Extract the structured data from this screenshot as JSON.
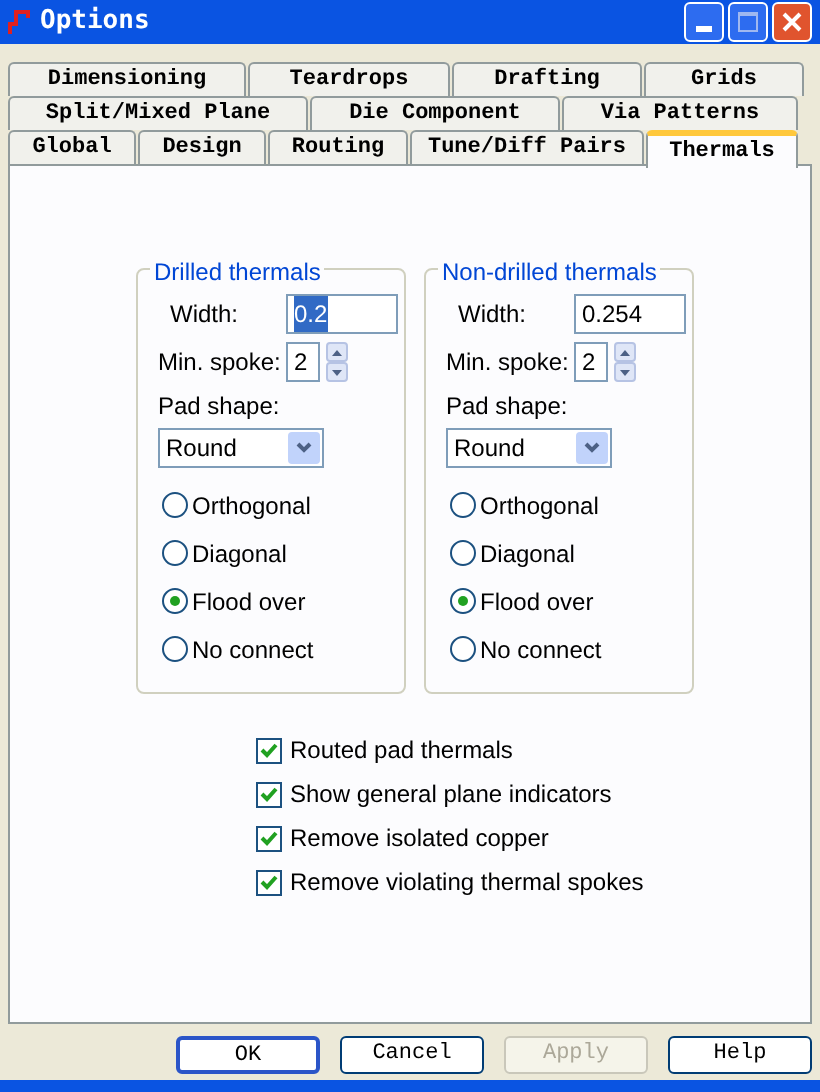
{
  "window": {
    "title": "Options"
  },
  "tab_rows": [
    [
      {
        "label": "Dimensioning",
        "selected": false
      },
      {
        "label": "Teardrops",
        "selected": false
      },
      {
        "label": "Drafting",
        "selected": false
      },
      {
        "label": "Grids",
        "selected": false
      }
    ],
    [
      {
        "label": "Split/Mixed Plane",
        "selected": false
      },
      {
        "label": "Die Component",
        "selected": false
      },
      {
        "label": "Via Patterns",
        "selected": false
      }
    ],
    [
      {
        "label": "Global",
        "selected": false
      },
      {
        "label": "Design",
        "selected": false
      },
      {
        "label": "Routing",
        "selected": false
      },
      {
        "label": "Tune/Diff Pairs",
        "selected": false
      },
      {
        "label": "Thermals",
        "selected": true
      }
    ]
  ],
  "groups": [
    {
      "title": "Drilled thermals",
      "width_label": "Width:",
      "width_value": "0.2",
      "width_text_selected": true,
      "spoke_label": "Min. spoke:",
      "spoke_value": "2",
      "pad_shape_label": "Pad shape:",
      "pad_shape": "Round",
      "options": [
        {
          "label": "Orthogonal",
          "selected": false
        },
        {
          "label": "Diagonal",
          "selected": false
        },
        {
          "label": "Flood over",
          "selected": true
        },
        {
          "label": "No connect",
          "selected": false
        }
      ]
    },
    {
      "title": "Non-drilled thermals",
      "width_label": "Width:",
      "width_value": "0.254",
      "width_text_selected": false,
      "spoke_label": "Min. spoke:",
      "spoke_value": "2",
      "pad_shape_label": "Pad shape:",
      "pad_shape": "Round",
      "options": [
        {
          "label": "Orthogonal",
          "selected": false
        },
        {
          "label": "Diagonal",
          "selected": false
        },
        {
          "label": "Flood over",
          "selected": true
        },
        {
          "label": "No connect",
          "selected": false
        }
      ]
    }
  ],
  "checkboxes": [
    {
      "label": "Routed pad thermals",
      "checked": true
    },
    {
      "label": "Show general plane indicators",
      "checked": true
    },
    {
      "label": "Remove isolated copper",
      "checked": true
    },
    {
      "label": "Remove violating thermal spokes",
      "checked": true
    }
  ],
  "buttons": [
    {
      "label": "OK",
      "disabled": false
    },
    {
      "label": "Cancel",
      "disabled": false
    },
    {
      "label": "Apply",
      "disabled": true
    },
    {
      "label": "Help",
      "disabled": false
    }
  ]
}
